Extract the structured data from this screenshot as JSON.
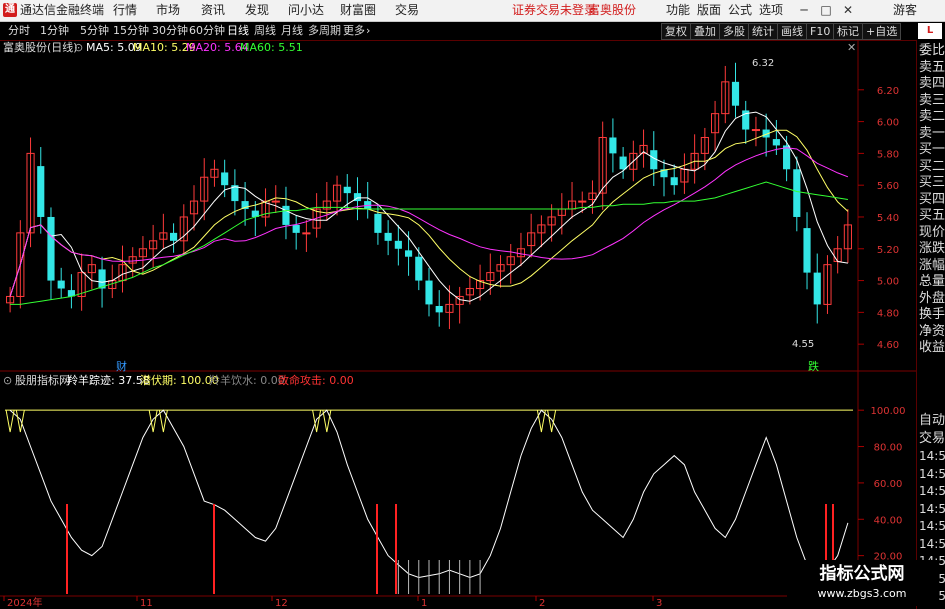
{
  "menubar": {
    "app_title": "通达信金融终端",
    "items": [
      "行情",
      "市场",
      "资讯",
      "发现",
      "问小达",
      "财富圈",
      "交易"
    ],
    "notice": "证券交易未登录",
    "stock": "富奥股份",
    "right_items": [
      "功能",
      "版面",
      "公式",
      "选项"
    ],
    "guest": "游客"
  },
  "toolbar": {
    "periods": [
      "分时",
      "1分钟",
      "5分钟",
      "15分钟",
      "30分钟",
      "60分钟",
      "日线",
      "周线",
      "月线",
      "多周期",
      "更多"
    ],
    "active_period": "日线",
    "right_buttons": [
      "复权",
      "叠加",
      "多股",
      "统计",
      "画线",
      "F10",
      "标记",
      "+自选"
    ],
    "l_button": "L"
  },
  "main_legend": {
    "title": "富奥股份(日线)",
    "ma5": "MA5: 5.09",
    "ma10": "MA10: 5.29",
    "ma20": "MA20: 5.64",
    "ma60": "MA60: 5.51",
    "colors": {
      "ma5": "#ffffff",
      "ma10": "#ffff66",
      "ma20": "#ff33ff",
      "ma60": "#33ff33"
    }
  },
  "indicator_legend": {
    "title": "股朋指标网",
    "line1": "羚羊踪迹: 37.58",
    "line2": "潜伏期: 100.00",
    "line3": "羚羊饮水: 0.00",
    "line4": "致命攻击: 0.00"
  },
  "price_axis": [
    "6.20",
    "6.00",
    "5.80",
    "5.60",
    "5.40",
    "5.20",
    "5.00",
    "4.80",
    "4.60"
  ],
  "indicator_axis": [
    "100.00",
    "80.00",
    "60.00",
    "40.00",
    "20.00"
  ],
  "annotations": {
    "high": "6.32",
    "low": "4.55",
    "cai": "财",
    "die": "跌"
  },
  "date_axis": [
    "2024年",
    "11",
    "12",
    "1",
    "2",
    "3"
  ],
  "right_panel": [
    "委比",
    "卖五",
    "卖四",
    "卖三",
    "卖二",
    "卖一",
    "买一",
    "买二",
    "买三",
    "买四",
    "买五",
    "现价",
    "涨跌",
    "涨幅",
    "总量",
    "外盘",
    "换手",
    "净资",
    "收益"
  ],
  "right_panel_lower": [
    "自动",
    "交易",
    "14:56",
    "14:56",
    "14:56",
    "14:56",
    "14:56",
    "14:56",
    "14:56",
    "14:56",
    "14:56"
  ],
  "watermark": {
    "line1": "指标公式网",
    "line2": "www.zbgs3.com"
  },
  "chart_data": {
    "type": "candlestick",
    "ylim": [
      4.45,
      6.4
    ],
    "close": [
      4.9,
      5.3,
      5.8,
      5.4,
      5.0,
      4.95,
      4.9,
      5.05,
      5.1,
      4.95,
      5.0,
      5.1,
      5.15,
      5.2,
      5.25,
      5.3,
      5.25,
      5.4,
      5.5,
      5.65,
      5.7,
      5.6,
      5.5,
      5.45,
      5.4,
      5.5,
      5.5,
      5.35,
      5.3,
      5.3,
      5.45,
      5.5,
      5.6,
      5.55,
      5.5,
      5.45,
      5.3,
      5.25,
      5.2,
      5.15,
      5.0,
      4.85,
      4.8,
      4.85,
      4.9,
      4.95,
      5.0,
      5.05,
      5.1,
      5.15,
      5.2,
      5.3,
      5.35,
      5.4,
      5.45,
      5.5,
      5.5,
      5.55,
      5.9,
      5.8,
      5.7,
      5.8,
      5.85,
      5.7,
      5.65,
      5.6,
      5.7,
      5.8,
      5.9,
      6.05,
      6.25,
      6.1,
      5.95,
      5.95,
      5.9,
      5.85,
      5.7,
      5.4,
      5.05,
      4.85,
      5.1,
      5.2,
      5.35
    ],
    "ma60": [
      4.85,
      4.85,
      4.86,
      4.87,
      4.88,
      4.89,
      4.9,
      4.92,
      4.94,
      4.96,
      4.98,
      5.0,
      5.02,
      5.05,
      5.08,
      5.1,
      5.13,
      5.16,
      5.19,
      5.22,
      5.26,
      5.3,
      5.34,
      5.38,
      5.4,
      5.42,
      5.43,
      5.44,
      5.44,
      5.45,
      5.46,
      5.46,
      5.46,
      5.46,
      5.45,
      5.45,
      5.45,
      5.45,
      5.45,
      5.45,
      5.45,
      5.45,
      5.45,
      5.45,
      5.45,
      5.45,
      5.45,
      5.45,
      5.45,
      5.45,
      5.45,
      5.45,
      5.45,
      5.45,
      5.45,
      5.45,
      5.46,
      5.46,
      5.47,
      5.47,
      5.48,
      5.48,
      5.48,
      5.49,
      5.49,
      5.5,
      5.5,
      5.5,
      5.51,
      5.52,
      5.54,
      5.56,
      5.58,
      5.6,
      5.62,
      5.6,
      5.58,
      5.56,
      5.55,
      5.54,
      5.53,
      5.52,
      5.51
    ],
    "indicator": [
      100,
      95,
      80,
      65,
      50,
      40,
      30,
      23,
      20,
      25,
      40,
      55,
      70,
      85,
      95,
      100,
      90,
      80,
      65,
      50,
      48,
      45,
      40,
      35,
      30,
      28,
      35,
      50,
      65,
      80,
      95,
      100,
      88,
      70,
      55,
      40,
      30,
      20,
      15,
      10,
      8,
      9,
      10,
      12,
      10,
      8,
      10,
      20,
      35,
      55,
      75,
      90,
      100,
      95,
      85,
      70,
      55,
      45,
      40,
      35,
      30,
      40,
      55,
      65,
      70,
      75,
      70,
      55,
      45,
      35,
      30,
      40,
      55,
      70,
      85,
      70,
      50,
      30,
      15,
      10,
      12,
      20,
      38
    ]
  }
}
